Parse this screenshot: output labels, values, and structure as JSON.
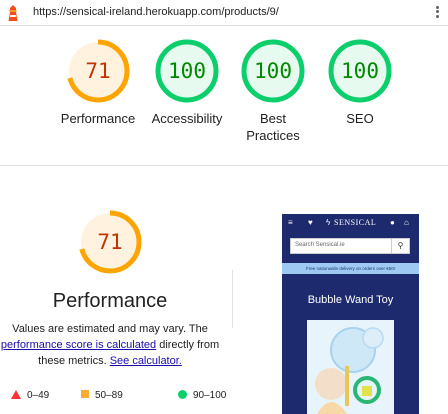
{
  "address_bar": {
    "url": "https://sensical-ireland.herokuapp.com/products/9/"
  },
  "scores": [
    {
      "label": "Performance",
      "value": "71",
      "score": 71,
      "color": "#ffa400",
      "fill": "#fff3e0",
      "text_color": "#c33300"
    },
    {
      "label": "Accessibility",
      "value": "100",
      "score": 100,
      "color": "#0cce6b",
      "fill": "#e6faf0",
      "text_color": "#008800"
    },
    {
      "label": "Best Practices",
      "value": "100",
      "score": 100,
      "color": "#0cce6b",
      "fill": "#e6faf0",
      "text_color": "#008800"
    },
    {
      "label": "SEO",
      "value": "100",
      "score": 100,
      "color": "#0cce6b",
      "fill": "#e6faf0",
      "text_color": "#008800"
    }
  ],
  "performance": {
    "value": "71",
    "score": 71,
    "title": "Performance",
    "desc_part1": "Values are estimated and may vary. The",
    "link1": "performance score is calculated",
    "desc_part2": " directly from these metrics.",
    "link2": "See calculator."
  },
  "legend": [
    {
      "range": "0–49",
      "color": "#ff3333",
      "shape": "triangle"
    },
    {
      "range": "50–89",
      "color": "#ffaa33",
      "shape": "square"
    },
    {
      "range": "90–100",
      "color": "#0cce6b",
      "shape": "circle"
    }
  ],
  "screenshot": {
    "brand": "SENSICAL",
    "search_placeholder": "Search Sensical.ie",
    "banner": "Free nationwide delivery on orders over €60!",
    "product_title": "Bubble Wand Toy"
  }
}
